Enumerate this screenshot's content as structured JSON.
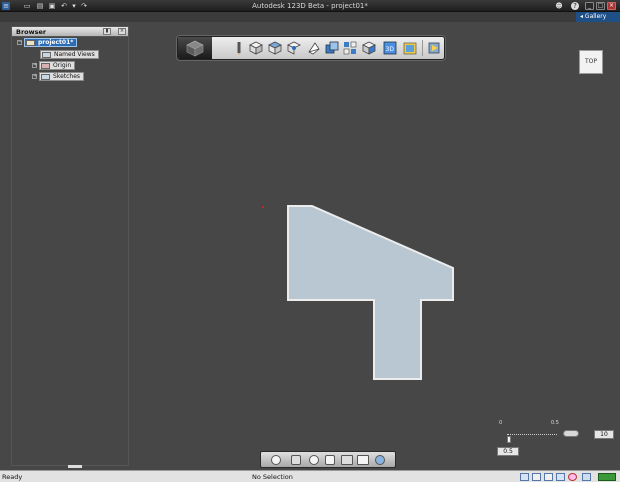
{
  "app": {
    "title": "Autodesk 123D Beta - project01*",
    "gallery_label": "Gallery"
  },
  "browser": {
    "title": "Browser",
    "root": {
      "label": "project01*"
    },
    "items": [
      {
        "label": "Named Views"
      },
      {
        "label": "Origin"
      },
      {
        "label": "Sketches"
      }
    ]
  },
  "viewcube": {
    "label": "TOP"
  },
  "grid": {
    "left_label": "0",
    "right_label": "0.5",
    "spacing_value": "10",
    "snap_value": "0.5"
  },
  "status": {
    "ready": "Ready",
    "selection": "No Selection"
  },
  "colors": {
    "viewport": "#474747",
    "sketch_fill": "#b8c7d1",
    "sketch_edge": "#ececec",
    "accent": "#2b6cb5"
  }
}
